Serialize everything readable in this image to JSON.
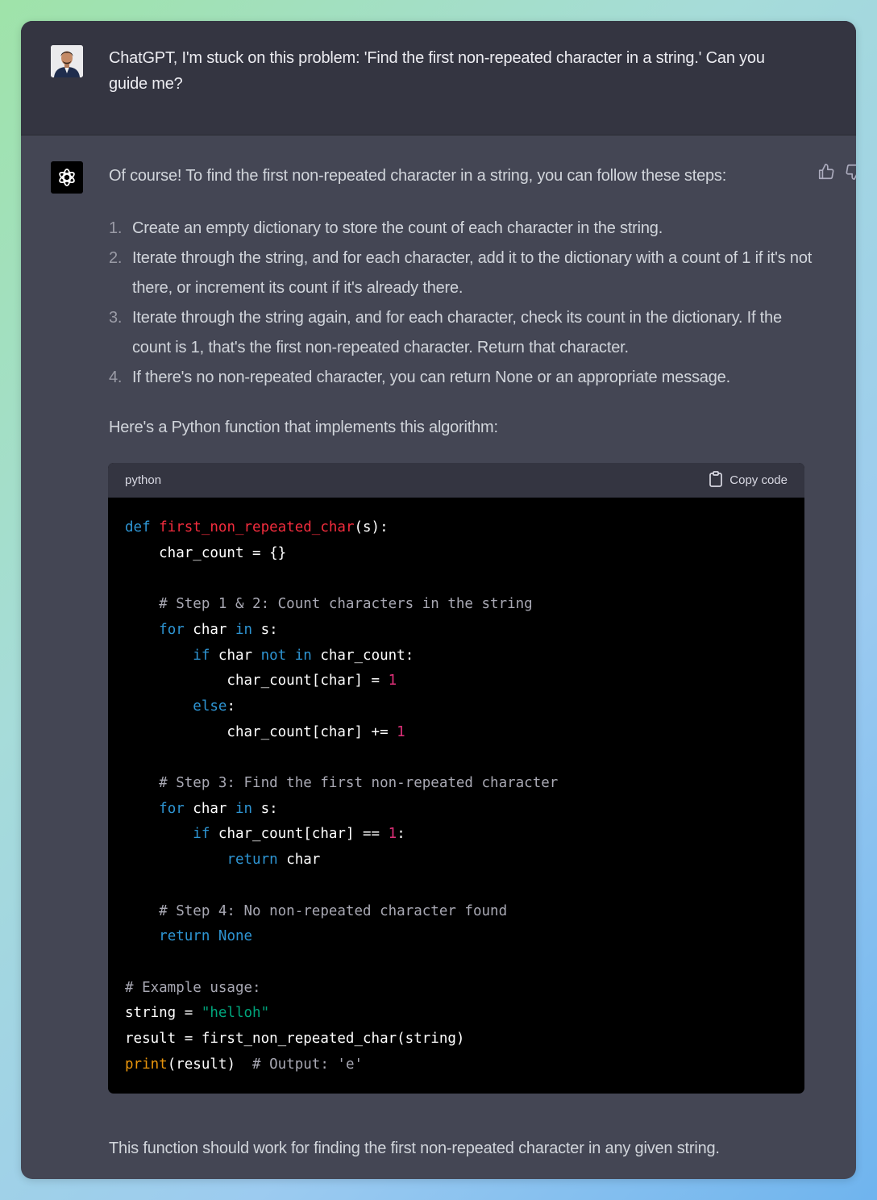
{
  "user_message": {
    "text": "ChatGPT, I'm stuck on this problem: 'Find the first non-repeated character in a string.' Can you guide me?"
  },
  "assistant_message": {
    "intro": "Of course! To find the first non-repeated character in a string, you can follow these steps:",
    "steps": [
      {
        "num": "1.",
        "text": "Create an empty dictionary to store the count of each character in the string."
      },
      {
        "num": "2.",
        "text": "Iterate through the string, and for each character, add it to the dictionary with a count of 1 if it's not there, or increment its count if it's already there."
      },
      {
        "num": "3.",
        "text": "Iterate through the string again, and for each character, check its count in the dictionary. If the count is 1, that's the first non-repeated character. Return that character."
      },
      {
        "num": "4.",
        "text": "If there's no non-repeated character, you can return None or an appropriate message."
      }
    ],
    "code_intro": "Here's a Python function that implements this algorithm:",
    "code": {
      "language": "python",
      "copy_label": "Copy code",
      "lines": [
        [
          [
            "kw",
            "def"
          ],
          [
            "t",
            " "
          ],
          [
            "fn",
            "first_non_repeated_char"
          ],
          [
            "t",
            "(s):"
          ]
        ],
        [
          [
            "t",
            "    char_count = {}"
          ]
        ],
        [],
        [
          [
            "cm",
            "    # Step 1 & 2: Count characters in the string"
          ]
        ],
        [
          [
            "t",
            "    "
          ],
          [
            "kw",
            "for"
          ],
          [
            "t",
            " char "
          ],
          [
            "kw",
            "in"
          ],
          [
            "t",
            " s:"
          ]
        ],
        [
          [
            "t",
            "        "
          ],
          [
            "kw",
            "if"
          ],
          [
            "t",
            " char "
          ],
          [
            "kw",
            "not"
          ],
          [
            "t",
            " "
          ],
          [
            "kw",
            "in"
          ],
          [
            "t",
            " char_count:"
          ]
        ],
        [
          [
            "t",
            "            char_count[char] = "
          ],
          [
            "num",
            "1"
          ]
        ],
        [
          [
            "t",
            "        "
          ],
          [
            "kw",
            "else"
          ],
          [
            "t",
            ":"
          ]
        ],
        [
          [
            "t",
            "            char_count[char] += "
          ],
          [
            "num",
            "1"
          ]
        ],
        [],
        [
          [
            "cm",
            "    # Step 3: Find the first non-repeated character"
          ]
        ],
        [
          [
            "t",
            "    "
          ],
          [
            "kw",
            "for"
          ],
          [
            "t",
            " char "
          ],
          [
            "kw",
            "in"
          ],
          [
            "t",
            " s:"
          ]
        ],
        [
          [
            "t",
            "        "
          ],
          [
            "kw",
            "if"
          ],
          [
            "t",
            " char_count[char] == "
          ],
          [
            "num",
            "1"
          ],
          [
            "t",
            ":"
          ]
        ],
        [
          [
            "t",
            "            "
          ],
          [
            "kw",
            "return"
          ],
          [
            "t",
            " char"
          ]
        ],
        [],
        [
          [
            "cm",
            "    # Step 4: No non-repeated character found"
          ]
        ],
        [
          [
            "t",
            "    "
          ],
          [
            "kw",
            "return"
          ],
          [
            "t",
            " "
          ],
          [
            "kw",
            "None"
          ]
        ],
        [],
        [
          [
            "cm",
            "# Example usage:"
          ]
        ],
        [
          [
            "t",
            "string = "
          ],
          [
            "str",
            "\"helloh\""
          ]
        ],
        [
          [
            "t",
            "result = first_non_repeated_char(string)"
          ]
        ],
        [
          [
            "bi",
            "print"
          ],
          [
            "t",
            "(result)  "
          ],
          [
            "cm",
            "# Output: 'e'"
          ]
        ]
      ]
    },
    "outro": "This function should work for finding the first non-repeated character in any given string."
  },
  "icons": {
    "user_avatar": "user-avatar-photo",
    "assistant": "openai-logo-icon",
    "like": "thumbs-up-icon",
    "dislike": "thumbs-down-icon",
    "copy": "clipboard-icon"
  },
  "colors": {
    "user_row_bg": "#343541",
    "assistant_row_bg": "#444654",
    "code_bg": "#000000",
    "keyword": "#2e95d3",
    "function_name": "#f22c3d",
    "number": "#df3079",
    "comment": "#a8a8b3",
    "string": "#00a67d",
    "builtin": "#e9950c"
  }
}
